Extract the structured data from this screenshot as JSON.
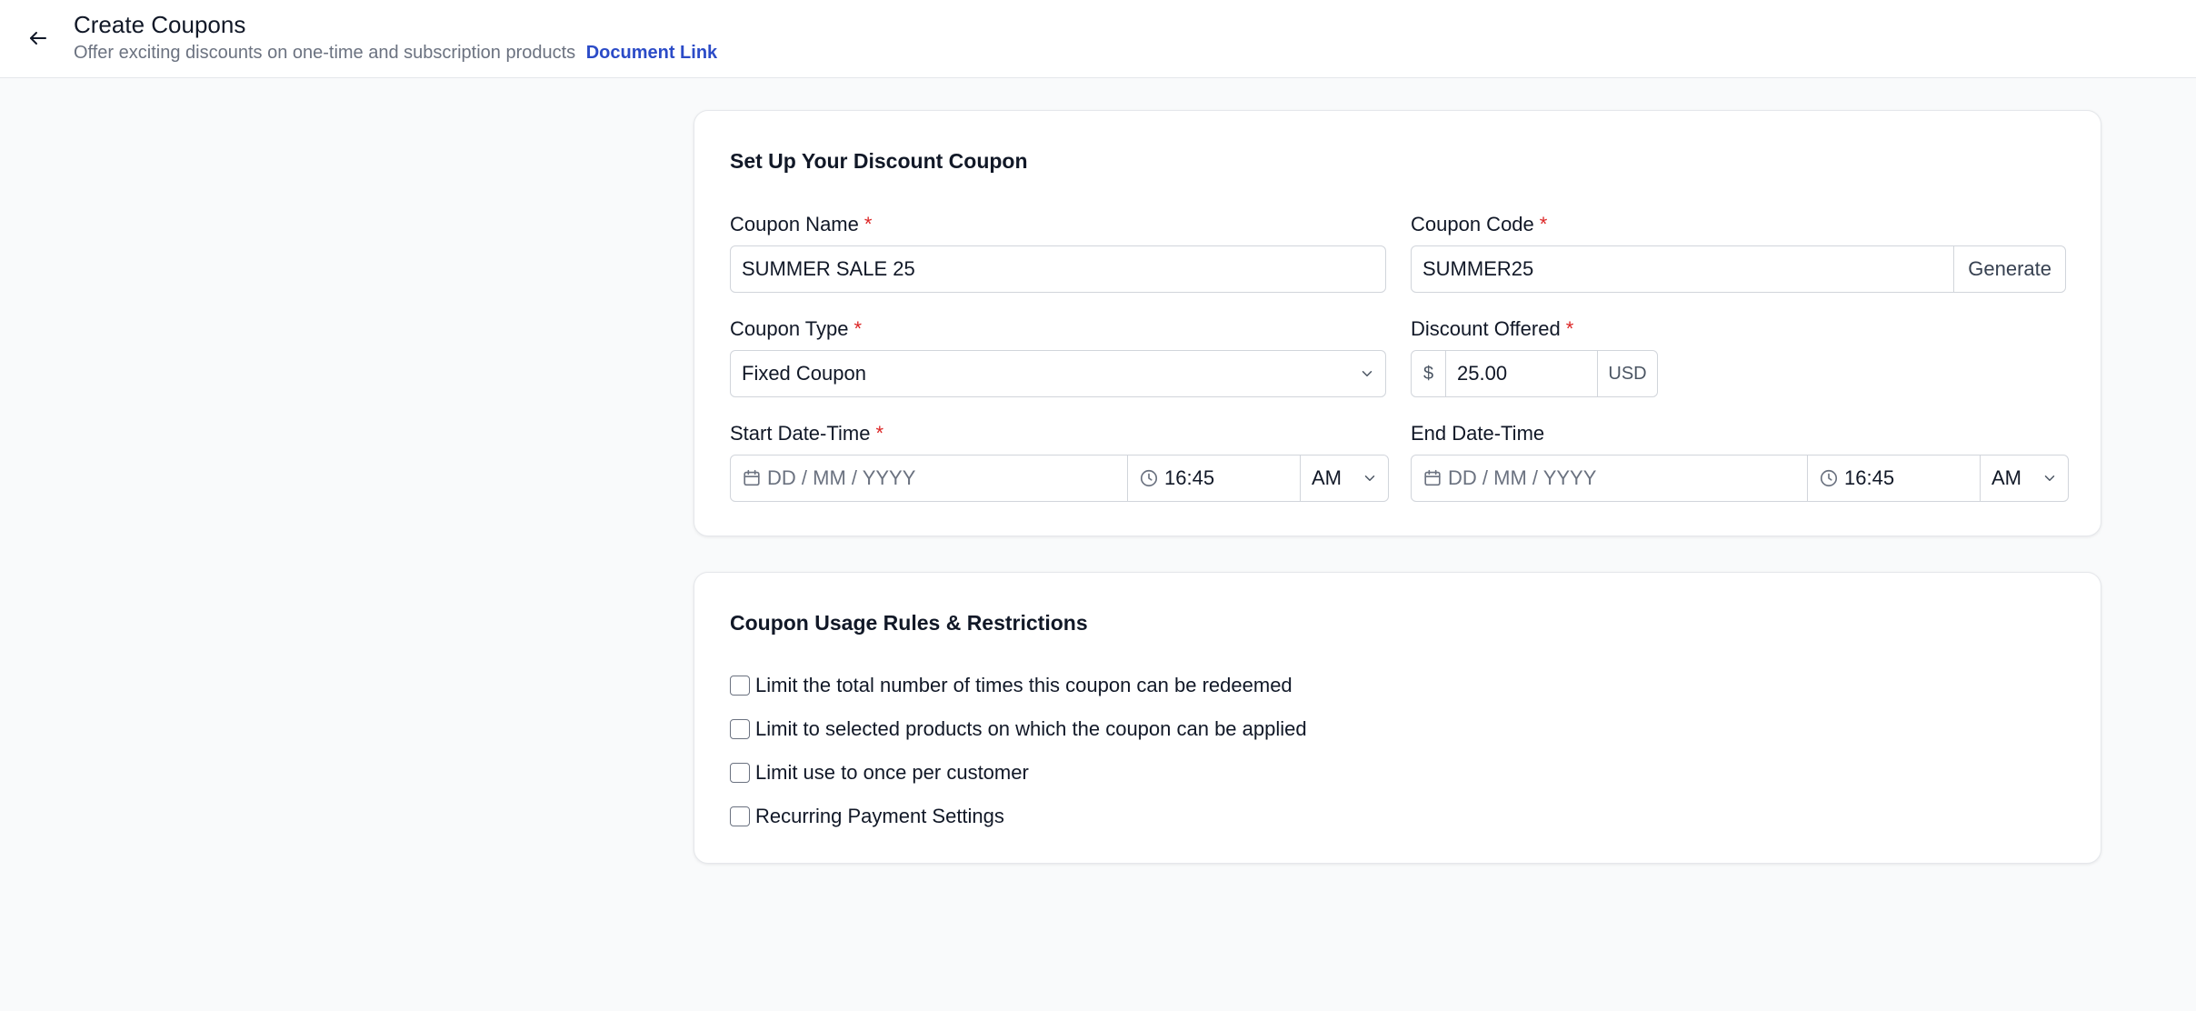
{
  "header": {
    "title": "Create Coupons",
    "subtitle": "Offer exciting discounts on one-time and subscription products",
    "doc_link": "Document Link"
  },
  "setup": {
    "title": "Set Up Your Discount Coupon",
    "coupon_name": {
      "label": "Coupon Name",
      "value": "SUMMER SALE 25"
    },
    "coupon_code": {
      "label": "Coupon Code",
      "value": "SUMMER25",
      "generate_label": "Generate"
    },
    "coupon_type": {
      "label": "Coupon Type",
      "value": "Fixed Coupon"
    },
    "discount": {
      "label": "Discount Offered",
      "prefix": "$",
      "value": "25.00",
      "suffix": "USD"
    },
    "start": {
      "label": "Start Date-Time",
      "date_placeholder": "DD / MM / YYYY",
      "time": "16:45",
      "period": "AM"
    },
    "end": {
      "label": "End Date-Time",
      "date_placeholder": "DD / MM / YYYY",
      "time": "16:45",
      "period": "AM"
    },
    "required_mark": "*"
  },
  "rules": {
    "title": "Coupon Usage Rules & Restrictions",
    "items": [
      "Limit the total number of times this coupon can be redeemed",
      "Limit to selected products on which the coupon can be applied",
      "Limit use to once per customer",
      "Recurring Payment Settings"
    ]
  },
  "colors": {
    "accent_link": "#2b4bc7",
    "required": "#dc2626",
    "border": "#d1d5db"
  }
}
